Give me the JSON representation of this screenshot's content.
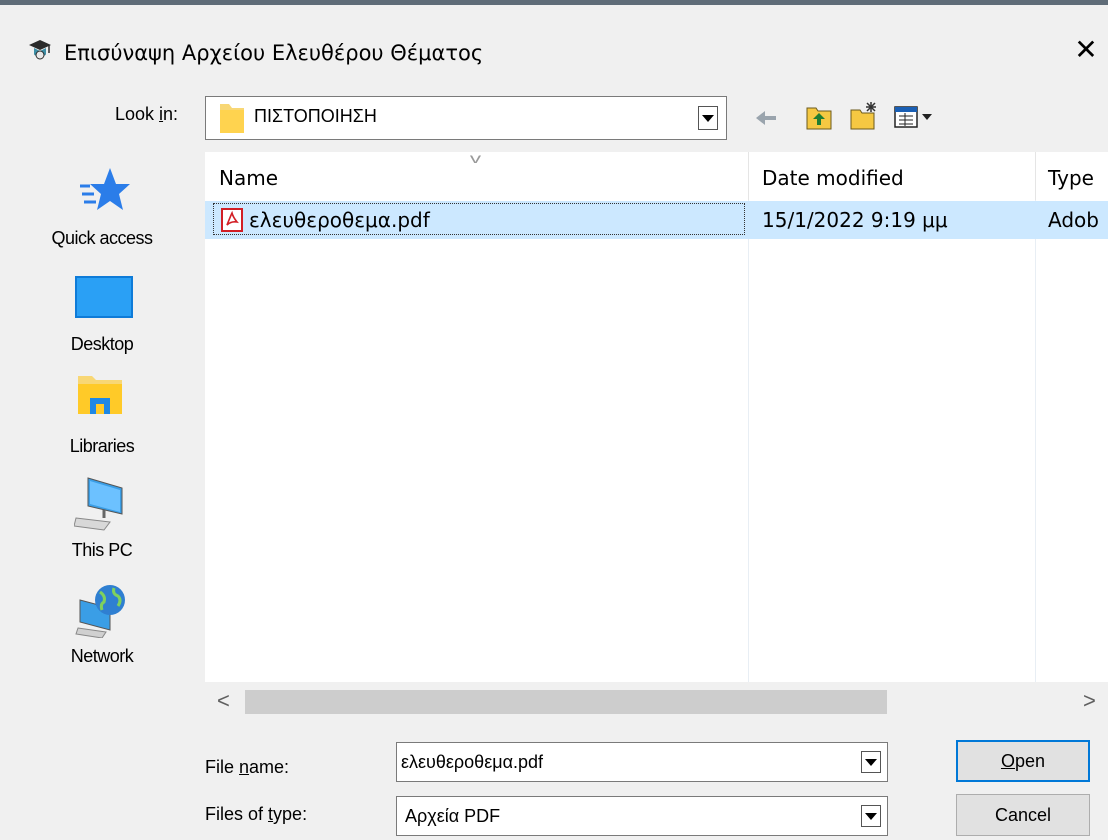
{
  "dialog": {
    "title": "Επισύναψη Αρχείου Ελευθέρου Θέματος",
    "close_symbol": "✕"
  },
  "lookin": {
    "label_prefix": "Look ",
    "label_accel": "i",
    "label_suffix": "n:",
    "value": "ΠΙΣΤΟΠΟΙΗΣΗ"
  },
  "toolbar": {
    "icons": [
      "back-arrow-icon",
      "up-folder-icon",
      "new-folder-icon",
      "view-menu-icon"
    ]
  },
  "sidebar": {
    "items": [
      {
        "label": "Quick access",
        "icon": "star-icon"
      },
      {
        "label": "Desktop",
        "icon": "desktop-icon"
      },
      {
        "label": "Libraries",
        "icon": "libraries-folder-icon"
      },
      {
        "label": "This PC",
        "icon": "computer-icon"
      },
      {
        "label": "Network",
        "icon": "network-icon"
      }
    ]
  },
  "filelist": {
    "columns": [
      "Name",
      "Date modified",
      "Type"
    ],
    "rows": [
      {
        "name": "ελευθεροθεμα.pdf",
        "date": "15/1/2022 9:19 μμ",
        "type": "Adob",
        "icon": "pdf-icon",
        "selected": true
      }
    ]
  },
  "scroll": {
    "left_arrow": "<",
    "right_arrow": ">"
  },
  "filename": {
    "label_prefix": "File ",
    "label_accel": "n",
    "label_suffix": "ame:",
    "value": "ελευθεροθεμα.pdf"
  },
  "filetype": {
    "label_prefix": "Files of ",
    "label_accel": "t",
    "label_suffix": "ype:",
    "value": "Αρχεία PDF"
  },
  "buttons": {
    "open_accel": "O",
    "open_rest": "pen",
    "cancel": "Cancel"
  },
  "colors": {
    "selection": "#cce8ff",
    "accent": "#0078d7",
    "pdf_red": "#d21f26"
  }
}
